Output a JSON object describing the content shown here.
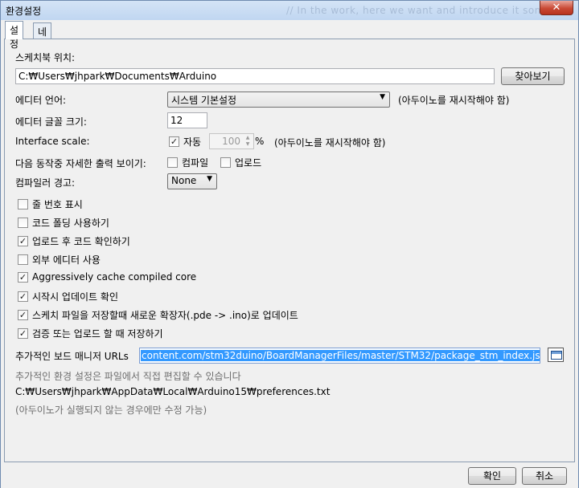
{
  "window": {
    "title": "환경설정",
    "ghost_text": "// In the work, here we want and introduce it some",
    "close_label": "✕"
  },
  "tabs": [
    {
      "label": "설정",
      "active": true
    },
    {
      "label": "네트워크",
      "active": false
    }
  ],
  "sketchbook": {
    "label": "스케치북 위치:",
    "value": "C:₩Users₩jhpark₩Documents₩Arduino",
    "browse_label": "찾아보기"
  },
  "editor_language": {
    "label": "에디터 언어:",
    "value": "시스템 기본설정",
    "note": "(아두이노를 재시작해야 함)"
  },
  "font_size": {
    "label": "에디터 글꼴 크기:",
    "value": "12"
  },
  "interface_scale": {
    "label": "Interface scale:",
    "auto_label": "자동",
    "auto_checked": true,
    "value": "100",
    "unit": "%",
    "note": "(아두이노를 재시작해야 함)"
  },
  "verbose_output": {
    "label": "다음 동작중 자세한 출력 보이기:",
    "compile_label": "컴파일",
    "compile_checked": false,
    "upload_label": "업로드",
    "upload_checked": false
  },
  "compiler_warnings": {
    "label": "컴파일러 경고:",
    "value": "None"
  },
  "options": [
    {
      "label": "줄 번호 표시",
      "checked": false
    },
    {
      "label": "코드 폴딩 사용하기",
      "checked": false
    },
    {
      "label": "업로드 후 코드 확인하기",
      "checked": true
    },
    {
      "label": "외부 에디터 사용",
      "checked": false
    },
    {
      "label": "Aggressively cache compiled core",
      "checked": true
    },
    {
      "label": "시작시 업데이트 확인",
      "checked": true
    },
    {
      "label": "스케치 파일을 저장할때 새로운 확장자(.pde -> .ino)로 업데이트",
      "checked": true
    },
    {
      "label": "검증 또는 업로드 할 때 저장하기",
      "checked": true
    }
  ],
  "board_manager": {
    "label": "추가적인 보드 매니저 URLs",
    "value": "content.com/stm32duino/BoardManagerFiles/master/STM32/package_stm_index.json"
  },
  "info": {
    "more_prefs": "추가적인 환경 설정은 파일에서 직접 편집할 수 있습니다",
    "path": "C:₩Users₩jhpark₩AppData₩Local₩Arduino15₩preferences.txt",
    "note": "(아두이노가 실행되지 않는 경우에만 수정 가능)"
  },
  "footer": {
    "ok_label": "확인",
    "cancel_label": "취소"
  }
}
